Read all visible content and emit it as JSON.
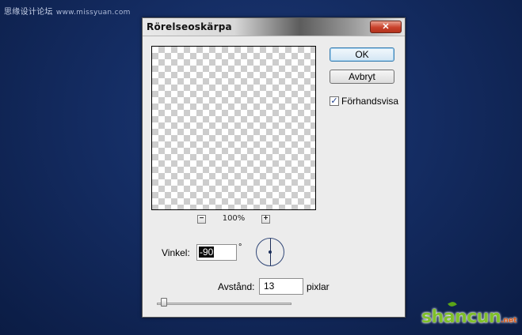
{
  "watermark": {
    "top_text": "思缘设计论坛",
    "top_url": "www.missyuan.com",
    "bottom_brand": "shancun",
    "bottom_suffix": ".net"
  },
  "dialog": {
    "title": "Rörelseoskärpa",
    "close_symbol": "✕",
    "ok_label": "OK",
    "cancel_label": "Avbryt",
    "preview_checkbox": {
      "label": "Förhandsvisa",
      "checked": true,
      "symbol": "✓"
    },
    "zoom": {
      "minus": "−",
      "plus": "+",
      "level": "100%"
    },
    "angle": {
      "label": "Vinkel:",
      "value": "-90",
      "unit": "°"
    },
    "distance": {
      "label": "Avstånd:",
      "value": "13",
      "unit": "pixlar"
    },
    "slider_fraction": 0.013
  },
  "colors": {
    "background": "#142c62",
    "dialog": "#ececec",
    "close_button": "#c9412b",
    "default_button_border": "#3c7fb1"
  }
}
